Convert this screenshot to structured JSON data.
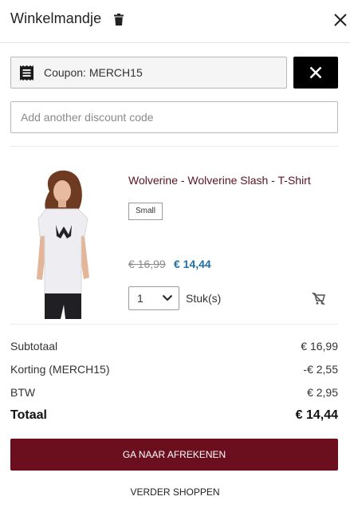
{
  "header": {
    "title": "Winkelmandje",
    "trash_icon": "trash-icon",
    "close_icon": "close-icon"
  },
  "coupon": {
    "label": "Coupon: MERCH15",
    "icon": "receipt-icon",
    "remove_icon": "close-icon"
  },
  "discount": {
    "placeholder": "Add another discount code"
  },
  "product": {
    "name": "Wolverine - Wolverine Slash - T-Shirt",
    "size": "Small",
    "old_price": "€ 16,99",
    "new_price": "€ 14,44",
    "quantity": "1",
    "unit": "Stuk(s)",
    "remove_icon": "cart-remove-icon"
  },
  "summary": {
    "subtotal_label": "Subtotaal",
    "subtotal_value": "€ 16,99",
    "discount_label": "Korting (MERCH15)",
    "discount_value": "-€ 2,55",
    "tax_label": "BTW",
    "tax_value": "€ 2,95",
    "total_label": "Totaal",
    "total_value": "€ 14,44"
  },
  "actions": {
    "checkout": "GA NAAR AFREKENEN",
    "continue": "VERDER SHOPPEN"
  },
  "colors": {
    "accent": "#6b0f1f",
    "product_name": "#5a1420",
    "sale_price": "#1f6fa3"
  }
}
